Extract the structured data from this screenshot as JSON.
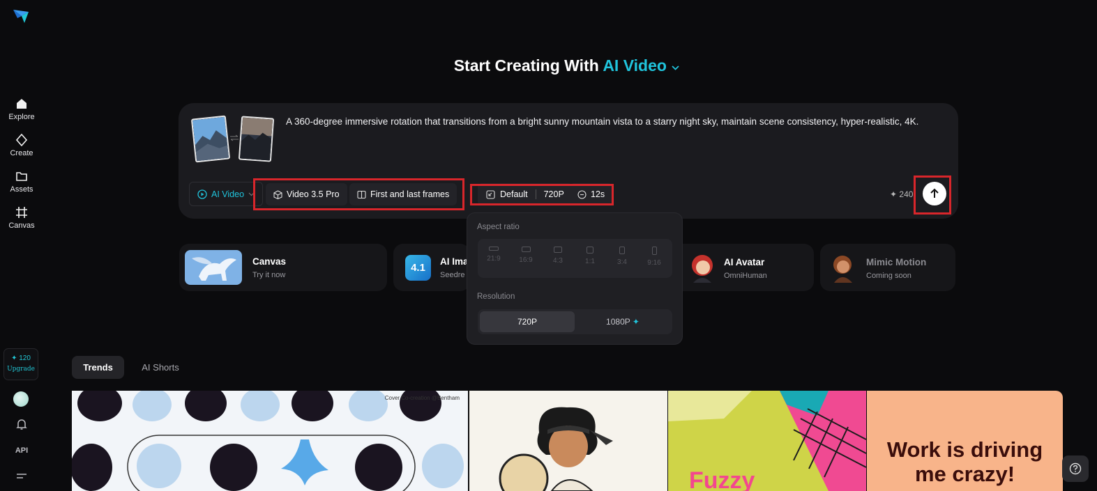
{
  "sidebar": {
    "items": [
      {
        "label": "Explore",
        "icon": "home-icon"
      },
      {
        "label": "Create",
        "icon": "sparkle-diamond-icon"
      },
      {
        "label": "Assets",
        "icon": "folder-icon"
      },
      {
        "label": "Canvas",
        "icon": "canvas-grid-icon"
      }
    ],
    "credits": "✦ 120",
    "upgrade": "Upgrade",
    "api": "API"
  },
  "header": {
    "title_prefix": "Start Creating With",
    "title_accent": "AI Video"
  },
  "prompt": {
    "text": "A 360-degree immersive rotation that transitions from a bright sunny mountain vista to a starry night sky, maintain scene consistency, hyper-realistic, 4K.",
    "mode": "AI Video",
    "model": "Video 3.5 Pro",
    "frames": "First and last frames",
    "aspect": "Default",
    "resolution": "720P",
    "duration": "12s",
    "cost": "✦ 240"
  },
  "features": [
    {
      "title": "Canvas",
      "subtitle": "Try it now"
    },
    {
      "title": "AI Ima",
      "subtitle": "Seedre"
    },
    {
      "title": "AI Avatar",
      "subtitle": "OmniHuman"
    },
    {
      "title": "Mimic Motion",
      "subtitle": "Coming soon"
    }
  ],
  "popover": {
    "aspect_label": "Aspect ratio",
    "ratios": [
      "21:9",
      "16:9",
      "4:3",
      "1:1",
      "3:4",
      "9:16"
    ],
    "resolution_label": "Resolution",
    "resolutions": [
      "720P",
      "1080P"
    ],
    "selected_resolution": "720P"
  },
  "tabs": [
    "Trends",
    "AI Shorts"
  ],
  "gallery": {
    "caption1": "Cover Co-creation @Bentham",
    "tile4_text_line1": "Work is driving",
    "tile4_text_line2": "me crazy!",
    "tile3_text": "Fuzzy"
  },
  "colors": {
    "accent": "#20c4dc",
    "highlight": "#d8262b",
    "background": "#0b0b0d"
  }
}
